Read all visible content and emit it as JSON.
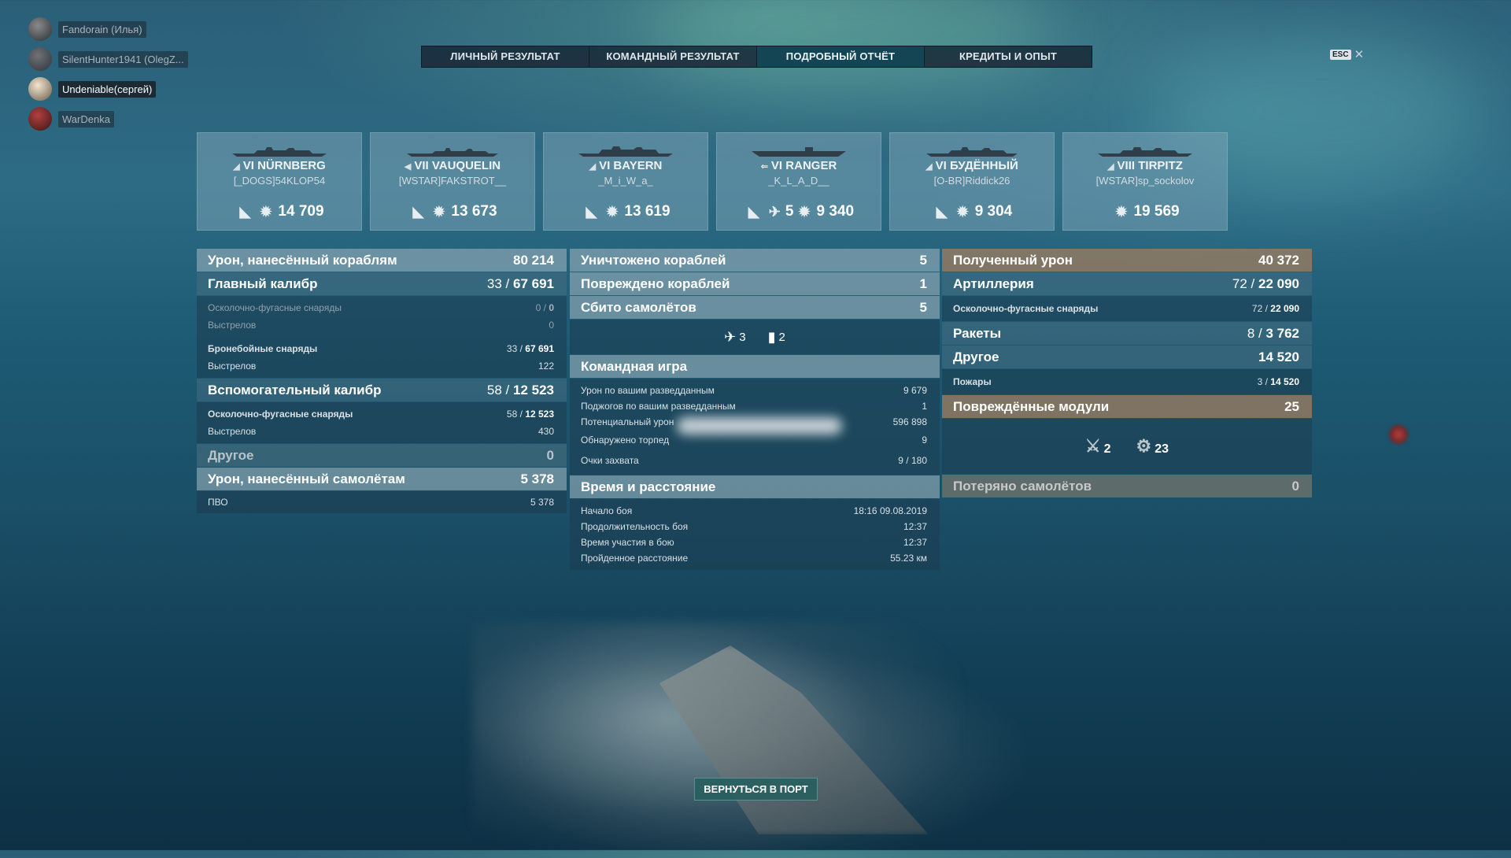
{
  "friends": [
    {
      "name": "Fandorain (Илья)",
      "active": false
    },
    {
      "name": "SilentHunter1941 (OlegZ...",
      "active": false
    },
    {
      "name": "Undeniable(сергей)",
      "active": true
    },
    {
      "name": "WarDenka",
      "active": false
    }
  ],
  "tabs": [
    {
      "label": "ЛИЧНЫЙ РЕЗУЛЬТАТ",
      "active": false
    },
    {
      "label": "КОМАНДНЫЙ РЕЗУЛЬТАТ",
      "active": false
    },
    {
      "label": "ПОДРОБНЫЙ ОТЧЁТ",
      "active": true
    },
    {
      "label": "КРЕДИТЫ И ОПЫТ",
      "active": false
    }
  ],
  "esc": {
    "key": "ESC",
    "close": "✕"
  },
  "ships": [
    {
      "tier": "VI",
      "name": "NÜRNBERG",
      "player": "[_DOGS]54KLOP54",
      "kills": "",
      "damage": "14 709"
    },
    {
      "tier": "VII",
      "name": "VAUQUELIN",
      "player": "[WSTAR]FAKSTROT__",
      "kills": "",
      "damage": "13 673"
    },
    {
      "tier": "VI",
      "name": "BAYERN",
      "player": "_M_i_W_a_",
      "kills": "",
      "damage": "13 619"
    },
    {
      "tier": "VI",
      "name": "RANGER",
      "player": "_K_L_A_D__",
      "kills": "5",
      "damage": "9 340"
    },
    {
      "tier": "VI",
      "name": "БУДЁННЫЙ",
      "player": "[O-BR]Riddick26",
      "kills": "",
      "damage": "9 304"
    },
    {
      "tier": "VIII",
      "name": "TIRPITZ",
      "player": "[WSTAR]sp_sockolov",
      "kills": "",
      "damage": "19 569"
    }
  ],
  "left": {
    "ship_damage": {
      "label": "Урон, нанесённый кораблям",
      "value": "80 214"
    },
    "main": {
      "label": "Главный калибр",
      "hits": "33",
      "total": "67 691"
    },
    "main_he": {
      "label": "Осколочно-фугасные снаряды",
      "hits": "0",
      "total": "0"
    },
    "main_he_shots": {
      "label": "Выстрелов",
      "value": "0"
    },
    "main_ap": {
      "label": "Бронебойные снаряды",
      "hits": "33",
      "total": "67 691"
    },
    "main_ap_shots": {
      "label": "Выстрелов",
      "value": "122"
    },
    "secondary": {
      "label": "Вспомогательный калибр",
      "hits": "58",
      "total": "12 523"
    },
    "sec_he": {
      "label": "Осколочно-фугасные снаряды",
      "hits": "58",
      "total": "12 523"
    },
    "sec_shots": {
      "label": "Выстрелов",
      "value": "430"
    },
    "other": {
      "label": "Другое",
      "value": "0"
    },
    "plane_damage": {
      "label": "Урон, нанесённый самолётам",
      "value": "5 378"
    },
    "aa": {
      "label": "ПВО",
      "value": "5 378"
    }
  },
  "middle": {
    "destroyed": {
      "label": "Уничтожено кораблей",
      "value": "5"
    },
    "damaged": {
      "label": "Повреждено кораблей",
      "value": "1"
    },
    "planes": {
      "label": "Сбито самолётов",
      "value": "5"
    },
    "plane_icons": [
      {
        "icon": "aircraft-icon",
        "value": "3"
      },
      {
        "icon": "aa-shell-icon",
        "value": "2"
      }
    ],
    "team_header": "Командная игра",
    "team_rows": [
      {
        "label": "Урон по вашим разведданным",
        "value": "9 679"
      },
      {
        "label": "Поджогов по вашим разведданным",
        "value": "1"
      },
      {
        "label": "Потенциальный урон",
        "value": "596 898"
      },
      {
        "label": "Обнаружено торпед",
        "value": "9"
      },
      {
        "label": "Очки захвата",
        "value": "9 / 180"
      }
    ],
    "time_header": "Время и расстояние",
    "time_rows": [
      {
        "label": "Начало боя",
        "value": "18:16  09.08.2019"
      },
      {
        "label": "Продолжительность боя",
        "value": "12:37"
      },
      {
        "label": "Время участия в бою",
        "value": "12:37"
      },
      {
        "label": "Пройденное расстояние",
        "value": "55.23 км"
      }
    ]
  },
  "right": {
    "received": {
      "label": "Полученный урон",
      "value": "40 372"
    },
    "artillery": {
      "label": "Артиллерия",
      "hits": "72",
      "total": "22 090"
    },
    "he": {
      "label": "Осколочно-фугасные снаряды",
      "hits": "72",
      "total": "22 090"
    },
    "rockets": {
      "label": "Ракеты",
      "hits": "8",
      "total": "3 762"
    },
    "other": {
      "label": "Другое",
      "value": "14 520"
    },
    "fires": {
      "label": "Пожары",
      "hits": "3",
      "total": "14 520"
    },
    "modules": {
      "label": "Повреждённые модули",
      "value": "25"
    },
    "module_icons": [
      {
        "icon": "weapon-module-icon",
        "value": "2"
      },
      {
        "icon": "steering-module-icon",
        "value": "23"
      }
    ],
    "lost_planes": {
      "label": "Потеряно самолётов",
      "value": "0"
    }
  },
  "return_button": "ВЕРНУТЬСЯ В ПОРТ",
  "colors": {
    "accent": "#286060",
    "brown_header": "#a07d5f",
    "panel": "#1e3c50"
  }
}
